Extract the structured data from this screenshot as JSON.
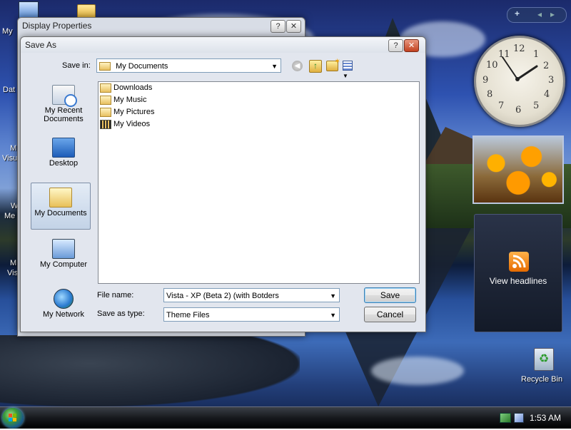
{
  "desktop": {
    "icons_left": [
      {
        "label": "My"
      },
      {
        "label": "Dat"
      },
      {
        "label": "M"
      },
      {
        "label": "Visu"
      },
      {
        "label": "W"
      },
      {
        "label": "Me"
      },
      {
        "label": "M"
      },
      {
        "label": "Vis"
      }
    ],
    "recycle_bin": "Recycle Bin"
  },
  "display_properties": {
    "title": "Display Properties",
    "help": "?",
    "close": "✕"
  },
  "save_as": {
    "title": "Save As",
    "help": "?",
    "close": "✕",
    "save_in_label": "Save in:",
    "save_in_value": "My Documents",
    "places": [
      {
        "label": "My Recent Documents",
        "icon": "recent-documents-icon"
      },
      {
        "label": "Desktop",
        "icon": "desktop-icon"
      },
      {
        "label": "My Documents",
        "icon": "my-documents-icon",
        "selected": true
      },
      {
        "label": "My Computer",
        "icon": "my-computer-icon"
      },
      {
        "label": "My Network",
        "icon": "my-network-icon"
      }
    ],
    "files": [
      {
        "name": "Downloads",
        "icon": "folder-icon"
      },
      {
        "name": "My Music",
        "icon": "music-folder-icon"
      },
      {
        "name": "My Pictures",
        "icon": "pictures-folder-icon"
      },
      {
        "name": "My Videos",
        "icon": "videos-folder-icon"
      }
    ],
    "file_name_label": "File name:",
    "file_name_value": "Vista - XP (Beta 2) (with Botders",
    "save_as_type_label": "Save as type:",
    "save_as_type_value": "Theme Files",
    "save_button": "Save",
    "cancel_button": "Cancel"
  },
  "sidebar": {
    "add_button": "+",
    "prev": "◂",
    "next": "▸",
    "clock_numbers": [
      "12",
      "1",
      "2",
      "3",
      "4",
      "5",
      "6",
      "7",
      "8",
      "9",
      "10",
      "11"
    ],
    "headlines_label": "View headlines"
  },
  "taskbar": {
    "time": "1:53 AM"
  }
}
